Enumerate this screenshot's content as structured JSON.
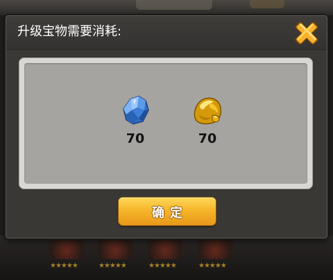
{
  "dialog": {
    "title": "升级宝物需要消耗:"
  },
  "costs": [
    {
      "name": "blue-crystal",
      "icon": "blue-crystal-icon",
      "amount": "70",
      "color": "#4a8fe0"
    },
    {
      "name": "gold-ore",
      "icon": "gold-ore-icon",
      "amount": "70",
      "color": "#f2b817"
    }
  ],
  "confirm_button": {
    "label": "确定"
  },
  "background": {
    "stars": "★★★★★"
  },
  "colors": {
    "accent": "#f6b52a",
    "close_icon": "#f5a623",
    "panel": "#3a3835"
  }
}
